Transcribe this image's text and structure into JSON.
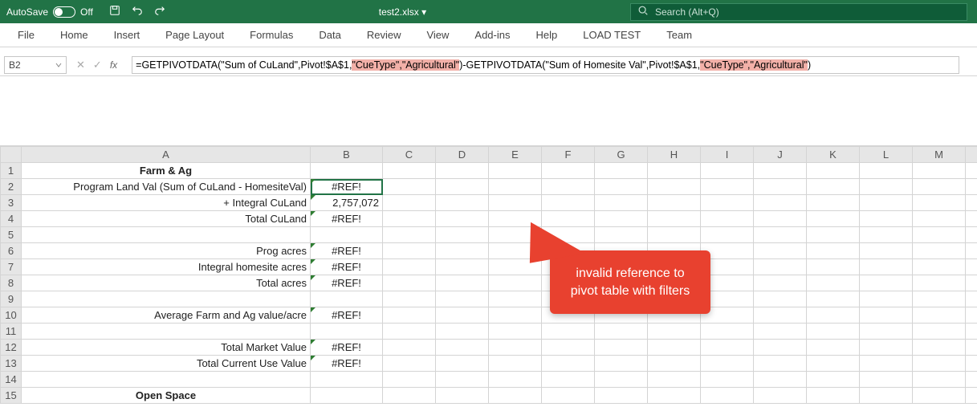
{
  "titlebar": {
    "autosave_label": "AutoSave",
    "autosave_state": "Off",
    "filename": "test2.xlsx  ▾"
  },
  "search": {
    "placeholder": "Search (Alt+Q)"
  },
  "ribbon": {
    "tabs": [
      "File",
      "Home",
      "Insert",
      "Page Layout",
      "Formulas",
      "Data",
      "Review",
      "View",
      "Add-ins",
      "Help",
      "LOAD TEST",
      "Team"
    ]
  },
  "namebox": {
    "value": "B2"
  },
  "formula": {
    "p1": "=GETPIVOTDATA(\"Sum of CuLand\",Pivot!$A$1,",
    "h1": "\"CueType\",\"Agricultural\"",
    "p2": ")-GETPIVOTDATA(\"Sum of Homesite Val\",Pivot!$A$1,",
    "h2": "\"CueType\",\"Agricultural\"",
    "p3": ")"
  },
  "columns": [
    "A",
    "B",
    "C",
    "D",
    "E",
    "F",
    "G",
    "H",
    "I",
    "J",
    "K",
    "L",
    "M",
    "N"
  ],
  "rows": [
    {
      "n": 1,
      "a": "Farm & Ag",
      "b": "",
      "a_class": "center bold",
      "b_class": ""
    },
    {
      "n": 2,
      "a": "Program Land Val (Sum of CuLand  -  HomesiteVal)",
      "b": "#REF!",
      "a_class": "right",
      "b_class": "center err-marker selected"
    },
    {
      "n": 3,
      "a": "+ Integral CuLand",
      "b": "2,757,072",
      "a_class": "right",
      "b_class": "right err-marker"
    },
    {
      "n": 4,
      "a": "Total CuLand",
      "b": "#REF!",
      "a_class": "right",
      "b_class": "center err-marker"
    },
    {
      "n": 5,
      "a": "",
      "b": "",
      "a_class": "",
      "b_class": ""
    },
    {
      "n": 6,
      "a": "Prog acres",
      "b": "#REF!",
      "a_class": "right",
      "b_class": "center err-marker"
    },
    {
      "n": 7,
      "a": "Integral homesite acres",
      "b": "#REF!",
      "a_class": "right",
      "b_class": "center err-marker"
    },
    {
      "n": 8,
      "a": "Total acres",
      "b": "#REF!",
      "a_class": "right",
      "b_class": "center err-marker"
    },
    {
      "n": 9,
      "a": "",
      "b": "",
      "a_class": "",
      "b_class": ""
    },
    {
      "n": 10,
      "a": "Average Farm and Ag value/acre",
      "b": "#REF!",
      "a_class": "right",
      "b_class": "center err-marker"
    },
    {
      "n": 11,
      "a": "",
      "b": "",
      "a_class": "",
      "b_class": ""
    },
    {
      "n": 12,
      "a": "Total Market Value",
      "b": "#REF!",
      "a_class": "right",
      "b_class": "center err-marker"
    },
    {
      "n": 13,
      "a": "Total Current Use Value",
      "b": "#REF!",
      "a_class": "right",
      "b_class": "center err-marker"
    },
    {
      "n": 14,
      "a": "",
      "b": "",
      "a_class": "",
      "b_class": ""
    },
    {
      "n": 15,
      "a": "Open Space",
      "b": "",
      "a_class": "center bold",
      "b_class": ""
    }
  ],
  "callout": {
    "text": "invalid reference to pivot table with filters"
  }
}
